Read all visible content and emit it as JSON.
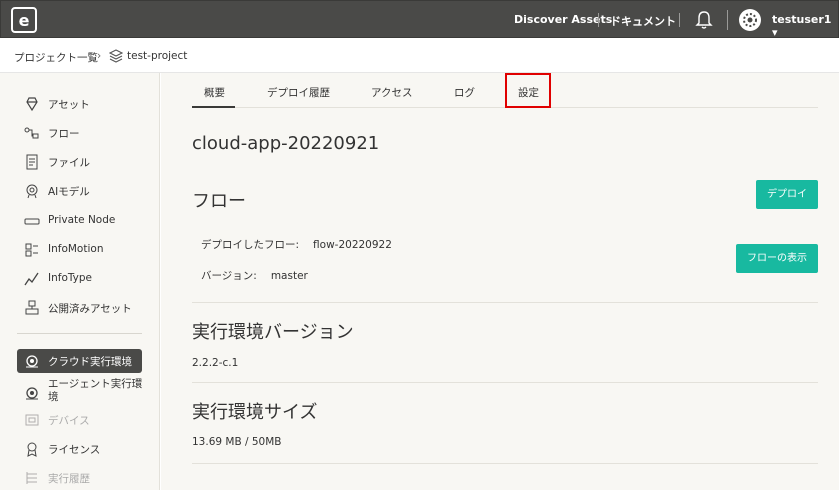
{
  "header": {
    "discover_label": "Discover Assets",
    "docs_label": "ドキュメント",
    "user_label": "testuser1 ▾"
  },
  "breadcrumb": {
    "root": "プロジェクト一覧",
    "sep": "›",
    "project": "test-project"
  },
  "sidebar": {
    "items": [
      {
        "label": "アセット",
        "icon": "diamond-icon"
      },
      {
        "label": "フロー",
        "icon": "flow-icon"
      },
      {
        "label": "ファイル",
        "icon": "file-icon"
      },
      {
        "label": "AIモデル",
        "icon": "ai-model-icon"
      },
      {
        "label": "Private Node",
        "icon": "node-icon"
      },
      {
        "label": "InfoMotion",
        "icon": "infomotion-icon"
      },
      {
        "label": "InfoType",
        "icon": "infotype-icon"
      },
      {
        "label": "公開済みアセット",
        "icon": "published-icon"
      },
      {
        "label": "クラウド実行環境",
        "icon": "cloud-runtime-icon"
      },
      {
        "label": "エージェント実行環境",
        "icon": "agent-runtime-icon"
      },
      {
        "label": "デバイス",
        "icon": "device-icon"
      },
      {
        "label": "ライセンス",
        "icon": "license-icon"
      },
      {
        "label": "実行履歴",
        "icon": "history-icon"
      }
    ]
  },
  "tabs": [
    {
      "label": "概要"
    },
    {
      "label": "デプロイ履歴"
    },
    {
      "label": "アクセス"
    },
    {
      "label": "ログ"
    },
    {
      "label": "設定"
    }
  ],
  "main": {
    "app_title": "cloud-app-20220921",
    "flow_section": {
      "title": "フロー",
      "deploy_button": "デプロイ",
      "deployed_flow_label": "デプロイしたフロー:",
      "deployed_flow_value": "flow-20220922",
      "version_label": "バージョン:",
      "version_value": "master",
      "show_flow_button": "フローの表示"
    },
    "runtime_version": {
      "title": "実行環境バージョン",
      "value": "2.2.2-c.1"
    },
    "runtime_size": {
      "title": "実行環境サイズ",
      "value": "13.69 MB / 50MB"
    }
  },
  "colors": {
    "topbar": "#4a4a48",
    "accent": "#18b9a0",
    "highlight": "#e00000"
  }
}
